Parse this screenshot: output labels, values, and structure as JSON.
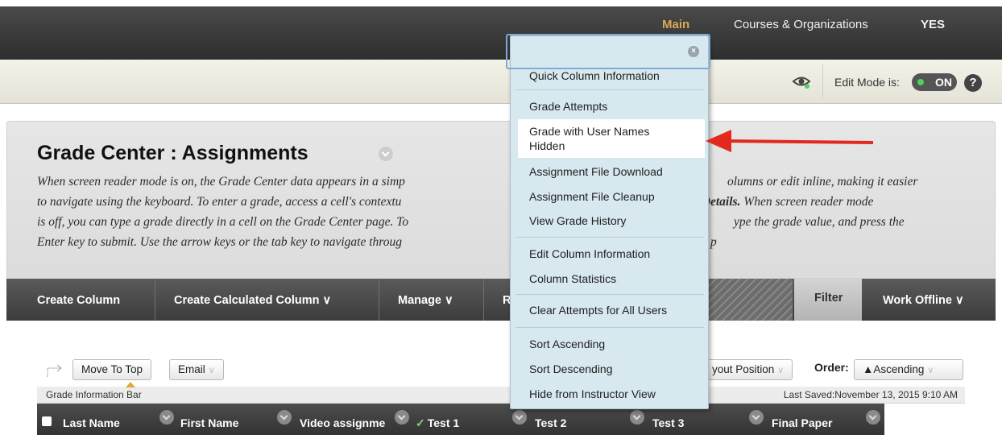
{
  "topnav": {
    "main": "Main",
    "courses": "Courses & Organizations",
    "user": "YES"
  },
  "editmode": {
    "label": "Edit Mode is:",
    "state": "ON",
    "help": "?"
  },
  "page": {
    "title": "Grade Center : Assignments",
    "desc_lines": [
      "When screen reader mode is on, the Grade Center data appears in a simp",
      "to navigate using the keyboard. To enter a grade, access a cell's contextu",
      "is off, you can type a grade directly in a cell on the Grade Center page. To",
      "Enter key to submit. Use the arrow keys or the tab key to navigate throug"
    ],
    "desc_right": [
      "olumns or edit inline, making it easier",
      " When screen reader mode",
      "ype the grade value, and press the",
      "p"
    ],
    "desc_right_bold": "e Details."
  },
  "actionbar": {
    "create_column": "Create Column",
    "create_calculated": "Create Calculated Column",
    "manage": "Manage",
    "r": "R",
    "filter": "Filter",
    "work_offline": "Work Offline",
    "chevron": "∨"
  },
  "toolbar": {
    "move_to_top": "Move To Top",
    "email": "Email",
    "layout_position": "yout Position",
    "order_label": "Order:",
    "order_value": "▲Ascending"
  },
  "infobar": {
    "left": "Grade Information Bar",
    "right": "Last Saved:November 13, 2015 9:10 AM"
  },
  "columns": [
    "Last Name",
    "First Name",
    "Video assignme",
    "Test 1",
    "Test 2",
    "Test 3",
    "Final Paper"
  ],
  "menu": {
    "items": [
      "Quick Column Information",
      "Grade Attempts",
      "Grade with User Names",
      "Hidden",
      "Assignment File Download",
      "Assignment File Cleanup",
      "View Grade History",
      "Edit Column Information",
      "Column Statistics",
      "Clear Attempts for All Users",
      "Sort Ascending",
      "Sort Descending",
      "Hide from Instructor View"
    ],
    "close": "×"
  },
  "colors": {
    "accent_arrow": "#e3281d",
    "menu_bg": "#d7e8ef",
    "toggle_on": "#4fd15e"
  }
}
